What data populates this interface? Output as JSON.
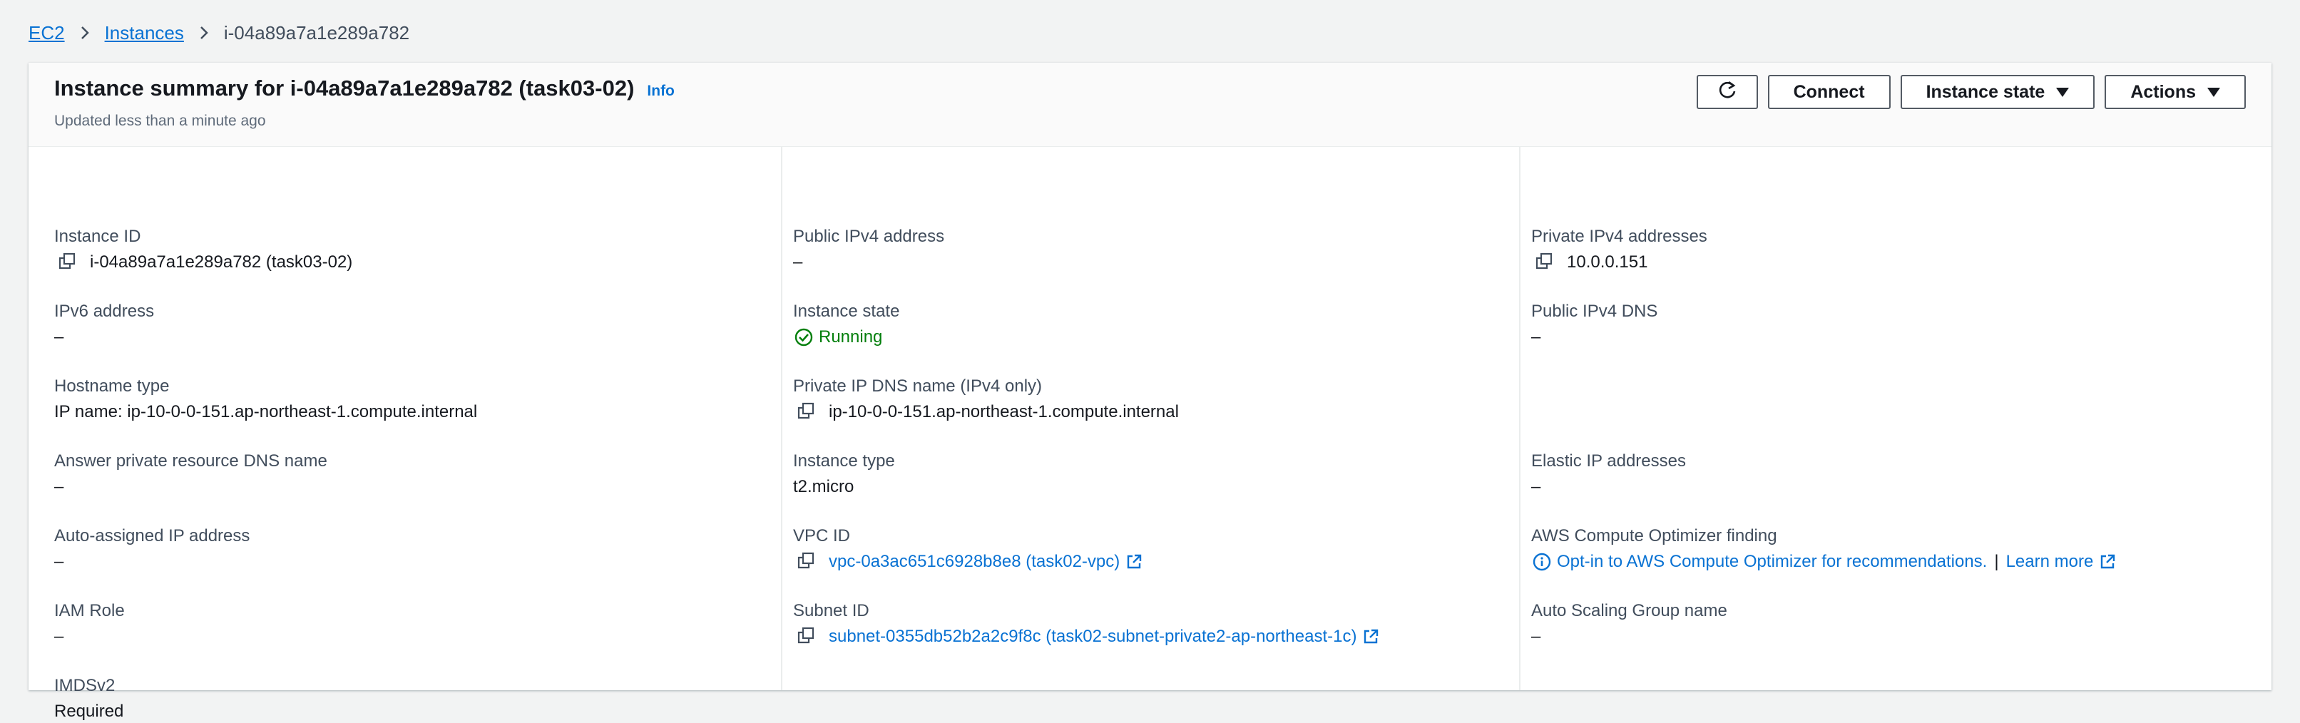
{
  "breadcrumb": {
    "items": [
      "EC2",
      "Instances",
      "i-04a89a7a1e289a782"
    ]
  },
  "header": {
    "title": "Instance summary for i-04a89a7a1e289a782 (task03-02)",
    "info_label": "Info",
    "subtitle": "Updated less than a minute ago",
    "buttons": {
      "connect": "Connect",
      "instance_state": "Instance state",
      "actions": "Actions"
    }
  },
  "details": {
    "instance_id": {
      "label": "Instance ID",
      "value": "i-04a89a7a1e289a782 (task03-02)"
    },
    "ipv6": {
      "label": "IPv6 address",
      "value": "–"
    },
    "hostname_type": {
      "label": "Hostname type",
      "value": "IP name: ip-10-0-0-151.ap-northeast-1.compute.internal"
    },
    "answer_dns": {
      "label": "Answer private resource DNS name",
      "value": "–"
    },
    "auto_ip": {
      "label": "Auto-assigned IP address",
      "value": "–"
    },
    "iam_role": {
      "label": "IAM Role",
      "value": "–"
    },
    "imdsv2": {
      "label": "IMDSv2",
      "value": "Required"
    },
    "public_ipv4": {
      "label": "Public IPv4 address",
      "value": "–"
    },
    "instance_state": {
      "label": "Instance state",
      "value": "Running"
    },
    "private_dns": {
      "label": "Private IP DNS name (IPv4 only)",
      "value": "ip-10-0-0-151.ap-northeast-1.compute.internal"
    },
    "instance_type": {
      "label": "Instance type",
      "value": "t2.micro"
    },
    "vpc_id": {
      "label": "VPC ID",
      "value": "vpc-0a3ac651c6928b8e8 (task02-vpc)"
    },
    "subnet_id": {
      "label": "Subnet ID",
      "value": "subnet-0355db52b2a2c9f8c (task02-subnet-private2-ap-northeast-1c)"
    },
    "private_ipv4": {
      "label": "Private IPv4 addresses",
      "value": "10.0.0.151"
    },
    "public_dns": {
      "label": "Public IPv4 DNS",
      "value": "–"
    },
    "elastic_ip": {
      "label": "Elastic IP addresses",
      "value": "–"
    },
    "optimizer": {
      "label": "AWS Compute Optimizer finding",
      "opt_in": "Opt-in to AWS Compute Optimizer for recommendations.",
      "separator": "|",
      "learn_more": "Learn more"
    },
    "asg_name": {
      "label": "Auto Scaling Group name",
      "value": "–"
    }
  },
  "colors": {
    "link": "#0972d3",
    "success": "#037f0c",
    "text": "#16191f",
    "label": "#414d5c"
  }
}
